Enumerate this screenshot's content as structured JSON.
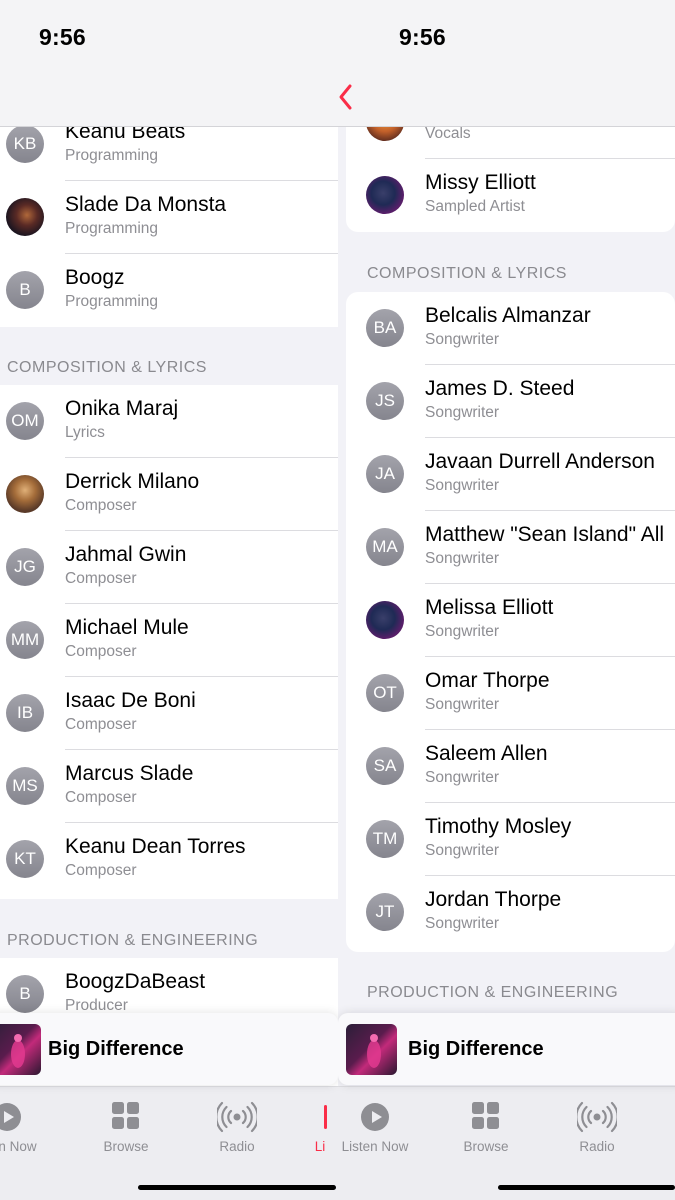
{
  "status": {
    "time": "9:56"
  },
  "colors": {
    "accent": "#fa2d48",
    "secondary_text": "#8e8e93",
    "avatar_gray": "#8e8e96"
  },
  "left": {
    "rows_top": [
      {
        "initials": "KB",
        "name": "Keanu Beats",
        "role": "Programming",
        "photo": false
      },
      {
        "initials": "",
        "name": "Slade Da Monsta",
        "role": "Programming",
        "photo": true
      },
      {
        "initials": "B",
        "name": "Boogz",
        "role": "Programming",
        "photo": false
      }
    ],
    "section_composition": "COMPOSITION & LYRICS",
    "composition": [
      {
        "initials": "OM",
        "name": "Onika Maraj",
        "role": "Lyrics",
        "photo": false
      },
      {
        "initials": "",
        "name": "Derrick Milano",
        "role": "Composer",
        "photo": true
      },
      {
        "initials": "JG",
        "name": "Jahmal Gwin",
        "role": "Composer",
        "photo": false
      },
      {
        "initials": "MM",
        "name": "Michael Mule",
        "role": "Composer",
        "photo": false
      },
      {
        "initials": "IB",
        "name": "Isaac De Boni",
        "role": "Composer",
        "photo": false
      },
      {
        "initials": "MS",
        "name": "Marcus Slade",
        "role": "Composer",
        "photo": false
      },
      {
        "initials": "KT",
        "name": "Keanu Dean Torres",
        "role": "Composer",
        "photo": false
      }
    ],
    "section_production": "PRODUCTION & ENGINEERING",
    "production": [
      {
        "initials": "B",
        "name": "BoogzDaBeast",
        "role": "Producer",
        "photo": false
      }
    ],
    "mini_player": {
      "title": "Big Difference"
    },
    "tabs": [
      {
        "label": "isten Now",
        "icon": "play-circle-icon"
      },
      {
        "label": "Browse",
        "icon": "grid-icon"
      },
      {
        "label": "Radio",
        "icon": "radio-waves-icon"
      },
      {
        "label": "Li",
        "icon": "library-icon"
      }
    ]
  },
  "right": {
    "rows_top": [
      {
        "initials": "",
        "name": "",
        "role": "Vocals",
        "photo": true
      },
      {
        "initials": "",
        "name": "Missy Elliott",
        "role": "Sampled Artist",
        "photo": true
      }
    ],
    "section_composition": "COMPOSITION & LYRICS",
    "composition": [
      {
        "initials": "BA",
        "name": "Belcalis Almanzar",
        "role": "Songwriter",
        "photo": false
      },
      {
        "initials": "JS",
        "name": "James D. Steed",
        "role": "Songwriter",
        "photo": false
      },
      {
        "initials": "JA",
        "name": "Javaan Durrell Anderson",
        "role": "Songwriter",
        "photo": false
      },
      {
        "initials": "MA",
        "name": "Matthew \"Sean Island\" All",
        "role": "Songwriter",
        "photo": false
      },
      {
        "initials": "",
        "name": "Melissa Elliott",
        "role": "Songwriter",
        "photo": true
      },
      {
        "initials": "OT",
        "name": "Omar Thorpe",
        "role": "Songwriter",
        "photo": false
      },
      {
        "initials": "SA",
        "name": "Saleem Allen",
        "role": "Songwriter",
        "photo": false
      },
      {
        "initials": "TM",
        "name": "Timothy Mosley",
        "role": "Songwriter",
        "photo": false
      },
      {
        "initials": "JT",
        "name": "Jordan Thorpe",
        "role": "Songwriter",
        "photo": false
      }
    ],
    "section_production": "PRODUCTION & ENGINEERING",
    "mini_player": {
      "title": "Big Difference"
    },
    "tabs": [
      {
        "label": "Listen Now",
        "icon": "play-circle-icon"
      },
      {
        "label": "Browse",
        "icon": "grid-icon"
      },
      {
        "label": "Radio",
        "icon": "radio-waves-icon"
      }
    ]
  }
}
